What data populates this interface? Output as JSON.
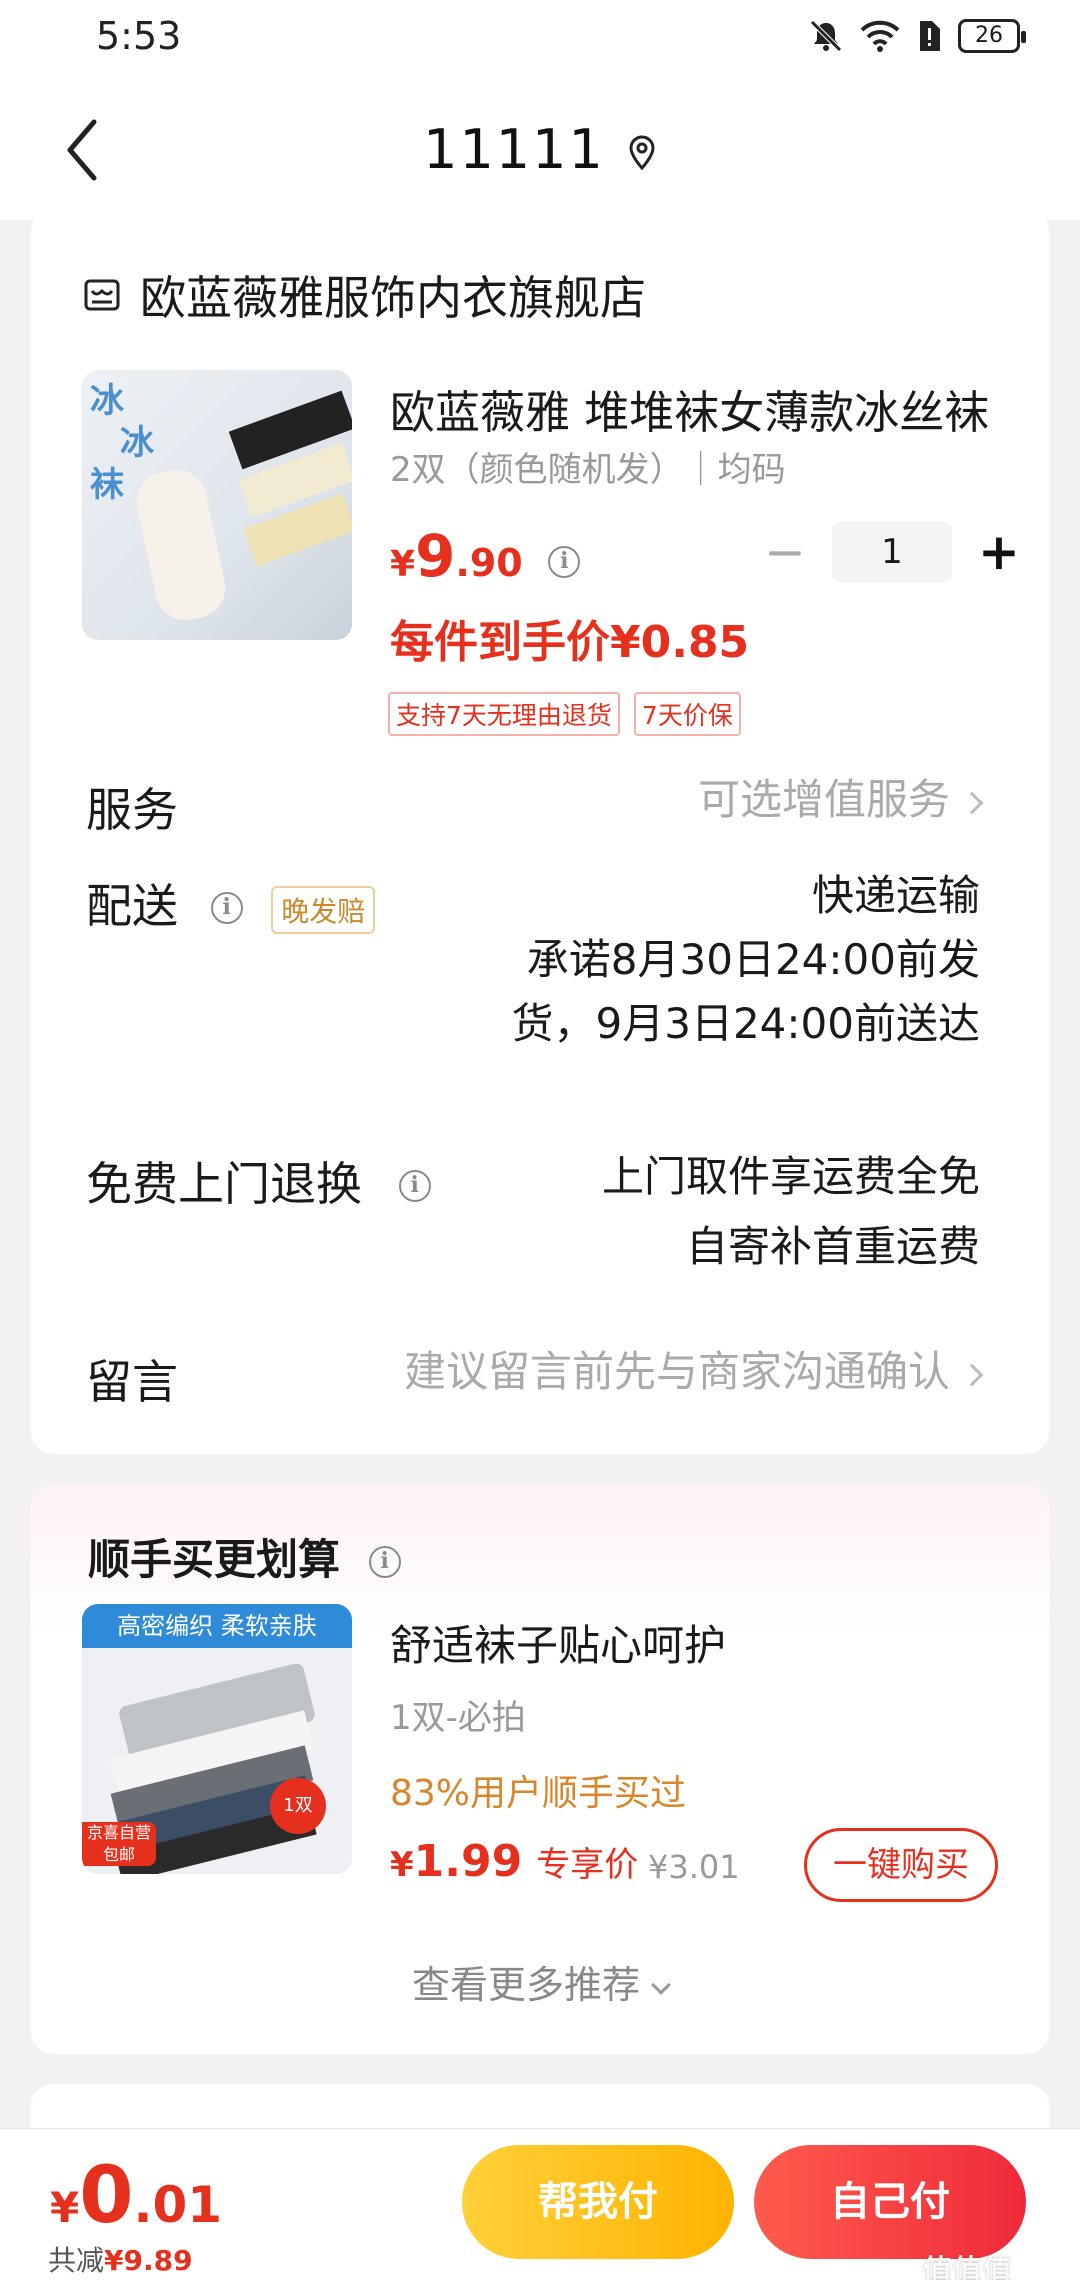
{
  "status_bar": {
    "time": "5:53",
    "battery": "26"
  },
  "header": {
    "title": "11111"
  },
  "order": {
    "shop_name": "欧蓝薇雅服饰内衣旗舰店",
    "product": {
      "title": "欧蓝薇雅 堆堆袜女薄款冰丝袜",
      "spec": "2双（颜色随机发）｜均码",
      "price_currency": "¥",
      "price_int": "9",
      "price_dec": ".90",
      "quantity": "1",
      "per_item_price": "每件到手价¥0.85",
      "tags": [
        "支持7天无理由退货",
        "7天价保"
      ],
      "image_text": [
        "冰",
        "冰",
        "袜"
      ]
    },
    "service": {
      "label": "服务",
      "value": "可选增值服务"
    },
    "delivery": {
      "label": "配送",
      "badge": "晚发赔",
      "method": "快递运输",
      "promise_line1": "承诺8月30日24:00前发",
      "promise_line2": "货，9月3日24:00前送达"
    },
    "return": {
      "label": "免费上门退换",
      "line1": "上门取件享运费全免",
      "line2": "自寄补首重运费"
    },
    "message": {
      "label": "留言",
      "placeholder": "建议留言前先与商家沟通确认"
    }
  },
  "recommend": {
    "title": "顺手买更划算",
    "item": {
      "banner": "高密编织 柔软亲肤",
      "name": "舒适袜子贴心呵护",
      "spec": "1双-必拍",
      "users": "83%用户顺手买过",
      "price_currency": "¥",
      "price": "1.99",
      "price_label": "专享价",
      "original_price": "¥3.01",
      "buy_label": "一键购买",
      "badge_jd": "京喜自营",
      "badge_free": "包邮",
      "badge_pair": "1双"
    },
    "more": "查看更多推荐"
  },
  "bottom": {
    "total_currency": "¥",
    "total_int": "0",
    "total_dec": ".01",
    "saved_label": "共减",
    "saved_value": "¥9.89",
    "help_pay": "帮我付",
    "self_pay": "自己付",
    "watermark": "值值值"
  },
  "colors": {
    "accent": "#e6301e",
    "yellow": "#ffb300",
    "orange_text": "#d9862a"
  }
}
